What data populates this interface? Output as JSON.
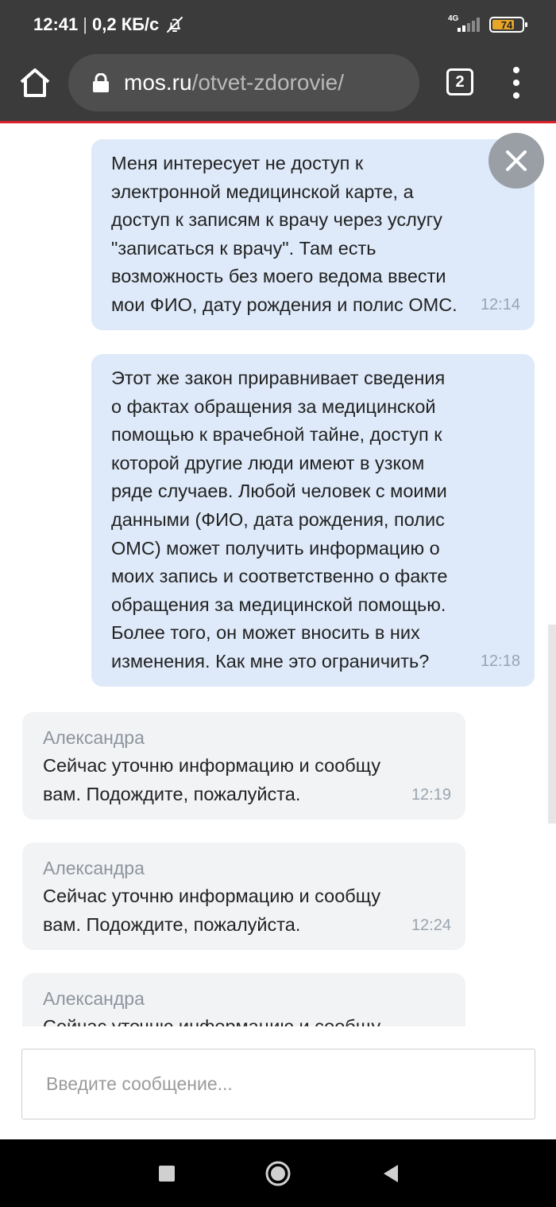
{
  "status_bar": {
    "time": "12:41",
    "separator": "|",
    "speed": "0,2 КБ/с",
    "network_type": "4G",
    "battery": "74",
    "battery_level": 0.74
  },
  "browser": {
    "url_domain": "mos.ru",
    "url_path": "/otvet-zdorovie/",
    "tab_count": "2"
  },
  "messages": [
    {
      "direction": "out",
      "text": "Меня интересует не доступ к\nэлектронной медицинской карте, а\nдоступ к записям к врачу через услугу\n\"записаться к врачу\". Там есть\nвозможность без моего ведома ввести\nмои ФИО, дату рождения и полис ОМС.",
      "time": "12:14"
    },
    {
      "direction": "out",
      "text": "Этот же закон приравнивает сведения\nо фактах обращения за медицинской\nпомощью к врачебной тайне, доступ к\nкоторой другие люди имеют в узком\nряде случаев. Любой человек с моими\nданными (ФИО, дата рождения, полис\nОМС) может получить информацию о\nмоих запись и соответственно о факте\nобращения за медицинской помощью.\nБолее того, он может вносить в них\nизменения. Как мне это ограничить?",
      "time": "12:18"
    },
    {
      "direction": "in",
      "author": "Александра",
      "text": "Сейчас уточню информацию и сообщу\nвам. Подождите, пожалуйста.",
      "time": "12:19"
    },
    {
      "direction": "in",
      "author": "Александра",
      "text": "Сейчас уточню информацию и сообщу\nвам. Подождите, пожалуйста.",
      "time": "12:24"
    },
    {
      "direction": "in",
      "author": "Александра",
      "text": "Сейчас уточню информацию и сообщу"
    }
  ],
  "input": {
    "placeholder": "Введите сообщение..."
  },
  "colors": {
    "outgoing_bubble": "#deeafa",
    "incoming_bubble": "#f2f3f5",
    "accent_red": "#d9202a",
    "browser_bar": "#3b3b3b"
  },
  "icons": {
    "home": "home-icon",
    "lock": "lock-icon",
    "menu": "more-vert-icon",
    "close": "close-icon",
    "dnd": "bell-off-icon",
    "recents": "square-icon",
    "home_nav": "circle-icon",
    "back": "triangle-back-icon"
  }
}
